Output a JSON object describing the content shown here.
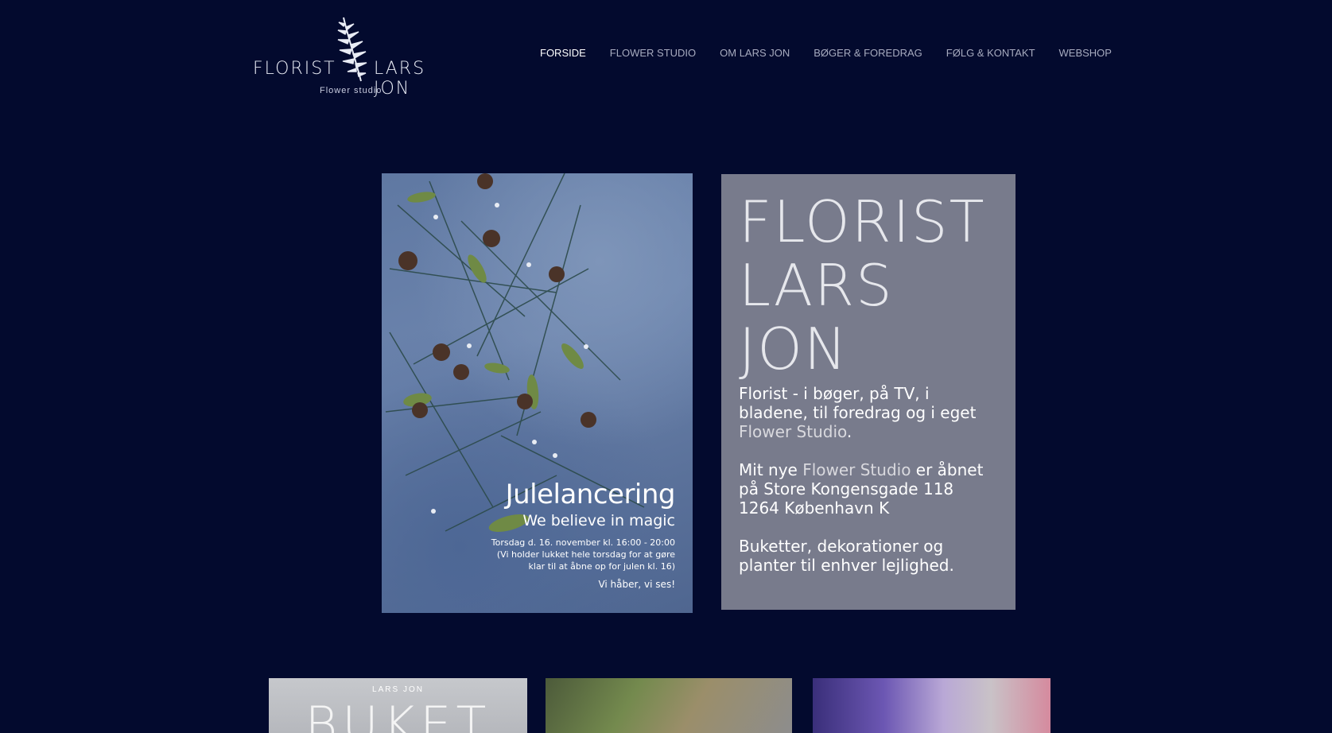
{
  "header": {
    "logo": {
      "left_text": "FLORIST",
      "right_text": "LARS JON",
      "tagline": "Flower studio",
      "icon": "fern-icon"
    },
    "nav": [
      {
        "label": "FORSIDE",
        "active": true
      },
      {
        "label": "FLOWER STUDIO",
        "active": false
      },
      {
        "label": "OM LARS JON",
        "active": false
      },
      {
        "label": "BØGER & FOREDRAG",
        "active": false
      },
      {
        "label": "FØLG & KONTAKT",
        "active": false
      },
      {
        "label": "WEBSHOP",
        "active": false
      }
    ]
  },
  "poster": {
    "title": "Julelancering",
    "subtitle": "We believe in magic",
    "line1": "Torsdag d. 16. november kl. 16:00 - 20:00",
    "line2": "(Vi holder lukket hele torsdag for at gøre",
    "line3": "klar til at åbne op for julen kl. 16)",
    "line4": "Vi håber, vi ses!"
  },
  "info": {
    "title_lines": [
      "FLORIST",
      "LARS",
      "JON"
    ],
    "p1_text": "Florist - i bøger, på TV, i bladene, til foredrag og i eget ",
    "p1_link": "Flower Studio",
    "p1_end": ".",
    "p2_start": "Mit nye ",
    "p2_link": "Flower Studio",
    "p2_rest": " er åbnet på Store Kongensgade 118",
    "p2_line2": "1264 København K",
    "p3": "Buketter, dekorationer og planter til enhver lejlighed."
  },
  "tiles": {
    "tile1_small": "LARS JON",
    "tile1_big": "BUKET"
  },
  "colors": {
    "background": "#030a2e",
    "info_box": "#787b8c",
    "nav_text": "#a7abbf",
    "nav_active": "#ffffff"
  }
}
